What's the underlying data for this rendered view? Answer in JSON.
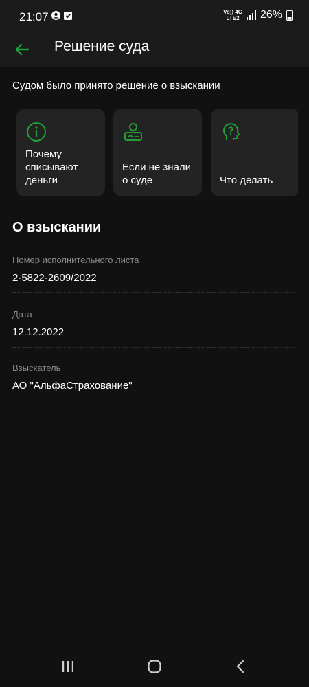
{
  "status_bar": {
    "time": "21:07",
    "network_top": "Vo)) 4G",
    "network_bottom": "LTE2",
    "battery": "26%"
  },
  "app_bar": {
    "title": "Решение суда",
    "back_icon": "arrow-left-icon"
  },
  "subtitle": "Судом было принято решение о взыскании",
  "cards": [
    {
      "icon": "info-circle-icon",
      "lines": [
        "Почему",
        "списывают",
        "деньги"
      ]
    },
    {
      "icon": "person-badge-icon",
      "lines": [
        "Если не знали",
        "о суде"
      ]
    },
    {
      "icon": "question-head-icon",
      "lines": [
        "Что делать"
      ]
    }
  ],
  "section": {
    "title": "О взыскании",
    "fields": [
      {
        "label": "Номер исполнительного листа",
        "value": "2-5822-2609/2022"
      },
      {
        "label": "Дата",
        "value": "12.12.2022"
      },
      {
        "label": "Взыскатель",
        "value": "АО \"АльфаСтрахование\""
      }
    ]
  },
  "colors": {
    "accent": "#21a038",
    "background": "#111111",
    "card": "#232323",
    "secondary_text": "#8a8a8a"
  },
  "nav_bar": {
    "icons": [
      "recent-apps-icon",
      "home-icon",
      "back-icon"
    ]
  }
}
